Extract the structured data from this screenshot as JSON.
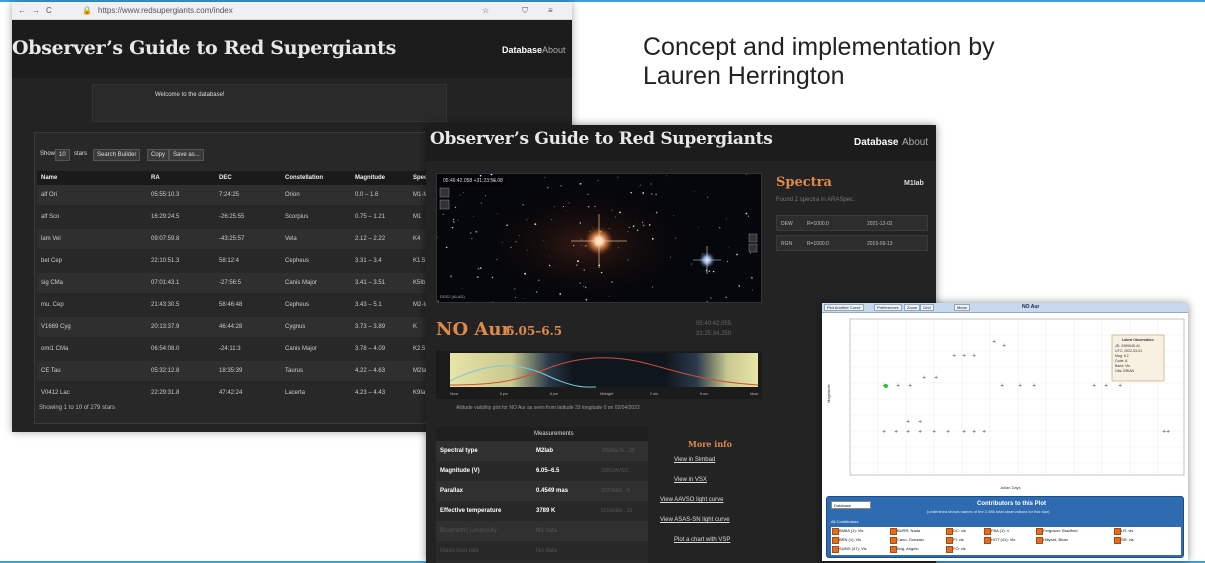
{
  "caption": {
    "line1": "Concept and implementation by",
    "line2": "Lauren Herrington"
  },
  "shot1": {
    "browser": {
      "back": "←",
      "forward": "→",
      "reload": "C",
      "url": "https://www.redsupergiants.com/index"
    },
    "site_title": "Observer’s Guide to Red Supergiants",
    "nav": {
      "database": "Database",
      "about": "About"
    },
    "welcome": "Welcome to the database!",
    "controls": {
      "show_label": "Show",
      "show_value": "10",
      "entries_label": "stars",
      "search_builder": "Search Builder",
      "copy": "Copy",
      "save_as": "Save as..."
    },
    "columns": [
      "Name",
      "RA",
      "DEC",
      "Constellation",
      "Magnitude",
      "Spectral"
    ],
    "rows": [
      [
        "alf Ori",
        "05:55:10.3",
        "7:24:25",
        "Orion",
        "0.0 – 1.6",
        "M1-M2"
      ],
      [
        "alf Sco",
        "16:29:24.5",
        "-26:25:55",
        "Scorpius",
        "0.75 – 1.21",
        "M1"
      ],
      [
        "lam Vel",
        "09:07:59.8",
        "-43:25:57",
        "Vela",
        "2.12 – 2.22",
        "K4"
      ],
      [
        "bet Cep",
        "22:10:51.3",
        "58:12:4",
        "Cepheus",
        "3.31 – 3.4",
        "K1.5Ib"
      ],
      [
        "sig CMa",
        "07:01:43.1",
        "-27:56:5",
        "Canis Major",
        "3.41 – 3.51",
        "K5Ib"
      ],
      [
        "mu. Cep",
        "21:43:30.5",
        "58:46:48",
        "Cepheus",
        "3.43 – 5.1",
        "M2-Ia"
      ],
      [
        "V1669 Cyg",
        "20:13:37.9",
        "46:44:28",
        "Cygnus",
        "3.73 – 3.89",
        "K"
      ],
      [
        "omi1 CMa",
        "06:54:08.0",
        "-24:11:3",
        "Canis Major",
        "3.78 – 4.09",
        "K2.5"
      ],
      [
        "CE Tau",
        "05:32:12.8",
        "18:35:39",
        "Taurus",
        "4.22 – 4.63",
        "M2Iab"
      ],
      [
        "V0412 Lac",
        "22:29:31.8",
        "47:42:24",
        "Lacerta",
        "4.23 – 4.43",
        "K9Ia"
      ]
    ],
    "footer": "Showing 1 to 10 of 279 stars"
  },
  "shot2": {
    "site_title": "Observer’s Guide to Red Supergiants",
    "nav": {
      "database": "Database",
      "about": "About"
    },
    "image_label": "05:46:42.058 +31:23:56.08",
    "image_credit": "DSS2 (ALAD)",
    "star_name": "NO Aur",
    "star_mag": "6.05–6.5",
    "coords1": "05:40:42.055",
    "coords2": "31:25:34.250",
    "plot_caption": "Altitude visibility plot for NO Aur as seen from latitude 33 longitude 0 on 02/04/2022",
    "plot_times": [
      "Noon",
      "6 pm",
      "6 pm",
      "Midnight",
      "2 am",
      "6 am",
      "Noon"
    ],
    "measurements_title": "Measurements",
    "measurements": [
      {
        "k": "Spectral type",
        "v": "M2Iab",
        "r": "1968ApJS…25",
        "dim": false
      },
      {
        "k": "Magnitude (V)",
        "v": "6.05–6.5",
        "r": "2009JAVSO…",
        "dim": false
      },
      {
        "k": "Parallax",
        "v": "0.4549 mas",
        "r": "2020A&A…6",
        "dim": false
      },
      {
        "k": "Effective temperature",
        "v": "3789 K",
        "r": "2018A&A…61",
        "dim": false
      },
      {
        "k": "Bolometric luminosity",
        "v": "No data",
        "r": "",
        "dim": true
      },
      {
        "k": "Mass-loss rate",
        "v": "No data",
        "r": "",
        "dim": true
      }
    ],
    "more_info_title": "More info",
    "more_links": [
      "View in Simbad",
      "View in VSX",
      "View AAVSO light curve",
      "View ASAS-SN light curve",
      "Plot a chart with VSP"
    ],
    "spectra_title": "Spectra",
    "spectra_class": "M1Iab",
    "spectra_found": "Found 2 spectra in ARASpec.",
    "spectra": [
      [
        "DEW",
        "R=1000.0",
        "2021-12-02"
      ],
      [
        "RGN",
        "R=1000.0",
        "2019-09-13"
      ]
    ]
  },
  "shot3": {
    "toolbar": [
      "Plot Another Curve",
      "Preferences",
      "Zoom",
      "Grid",
      "Mean"
    ],
    "title": "NO Aur",
    "tooltip": {
      "title": "Latest Observation",
      "lines": [
        "JD: 2459645.44",
        "UTC: 2022-03-01",
        "Mag: 6.2",
        "Code: A",
        "Band: Vis",
        "Obs: BRIAN"
      ]
    },
    "ylabel": "Magnitude",
    "xlabel": "Julian Days",
    "database_select": "Database",
    "contrib_title": "Contributors to this Plot",
    "contrib_sub": "(underlined shows names of the 2,386 total observations for this star)",
    "all_contrib": "All Contributors",
    "contributors": [
      [
        "BNBA (1): Vis",
        "BURR: Nada",
        "DC: vis",
        "FBA (1): V",
        "Ferguson: Bradford",
        "LR: vis"
      ],
      [
        "BRN (1): Vis",
        "Cano, Gonzalo",
        "FI: vis",
        "HOT (41): Vis",
        "Hillyard, Brian",
        "SR: vis"
      ],
      [
        "SUMS (47): Vis",
        "Brig, Angelo",
        "FO: vis",
        "",
        "",
        ""
      ]
    ]
  }
}
